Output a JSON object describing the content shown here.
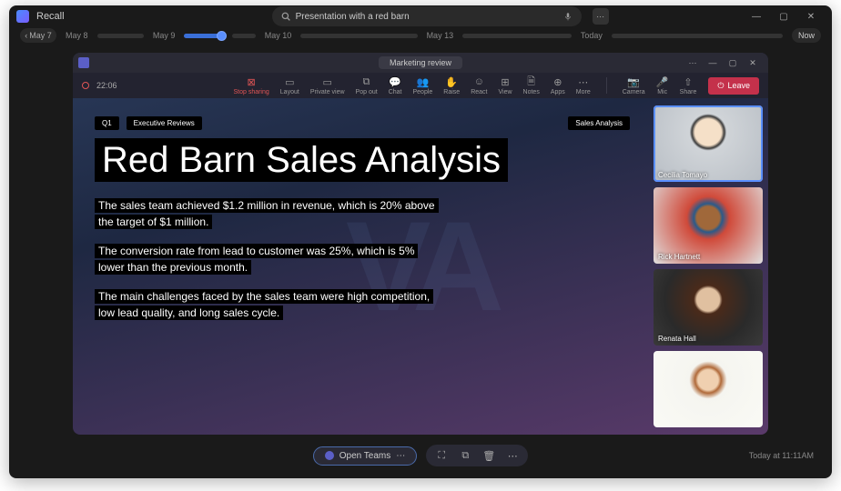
{
  "app": {
    "title": "Recall"
  },
  "search": {
    "value": "Presentation with a red barn"
  },
  "window_controls": {
    "min": "—",
    "max": "▢",
    "close": "✕"
  },
  "timeline": {
    "prev_label": "May 7",
    "labels": [
      "May 8",
      "May 9",
      "May 10",
      "May 13",
      "Today"
    ],
    "now_label": "Now"
  },
  "teams": {
    "title": "Marketing review",
    "rec_time": "22:06",
    "toolbar": [
      {
        "id": "stop-sharing",
        "label": "Stop sharing",
        "icon": "⊠",
        "stop": true
      },
      {
        "id": "layout",
        "label": "Layout",
        "icon": "▭"
      },
      {
        "id": "private-view",
        "label": "Private view",
        "icon": "▭"
      },
      {
        "id": "pop-out",
        "label": "Pop out",
        "icon": "⧉"
      },
      {
        "id": "chat",
        "label": "Chat",
        "icon": "💬"
      },
      {
        "id": "people",
        "label": "People",
        "icon": "👥"
      },
      {
        "id": "raise",
        "label": "Raise",
        "icon": "✋"
      },
      {
        "id": "react",
        "label": "React",
        "icon": "☺"
      },
      {
        "id": "view",
        "label": "View",
        "icon": "⊞"
      },
      {
        "id": "notes",
        "label": "Notes",
        "icon": "🗎"
      },
      {
        "id": "apps",
        "label": "Apps",
        "icon": "⊕"
      },
      {
        "id": "more",
        "label": "More",
        "icon": "⋯"
      }
    ],
    "media": [
      {
        "id": "camera",
        "label": "Camera",
        "icon": "📷"
      },
      {
        "id": "mic",
        "label": "Mic",
        "icon": "🎤"
      },
      {
        "id": "share",
        "label": "Share",
        "icon": "⇧"
      }
    ],
    "leave_label": "Leave"
  },
  "slide": {
    "tag_q": "Q1",
    "tag_section": "Executive Reviews",
    "tag_right": "Sales Analysis",
    "title": "Red Barn Sales Analysis",
    "p1": "The sales team achieved $1.2 million in revenue, which is 20% above the target of $1 million.",
    "p2": "The conversion rate from lead to customer was 25%, which is 5% lower than the previous month.",
    "p3": "The main challenges faced by the sales team were high competition, low lead quality, and long sales cycle."
  },
  "participants": [
    {
      "name": "Cecilia Tomayo"
    },
    {
      "name": "Rick Hartnett"
    },
    {
      "name": "Renata Hall"
    },
    {
      "name": ""
    }
  ],
  "bottom": {
    "open_label": "Open Teams",
    "timestamp": "Today at 11:11AM"
  }
}
